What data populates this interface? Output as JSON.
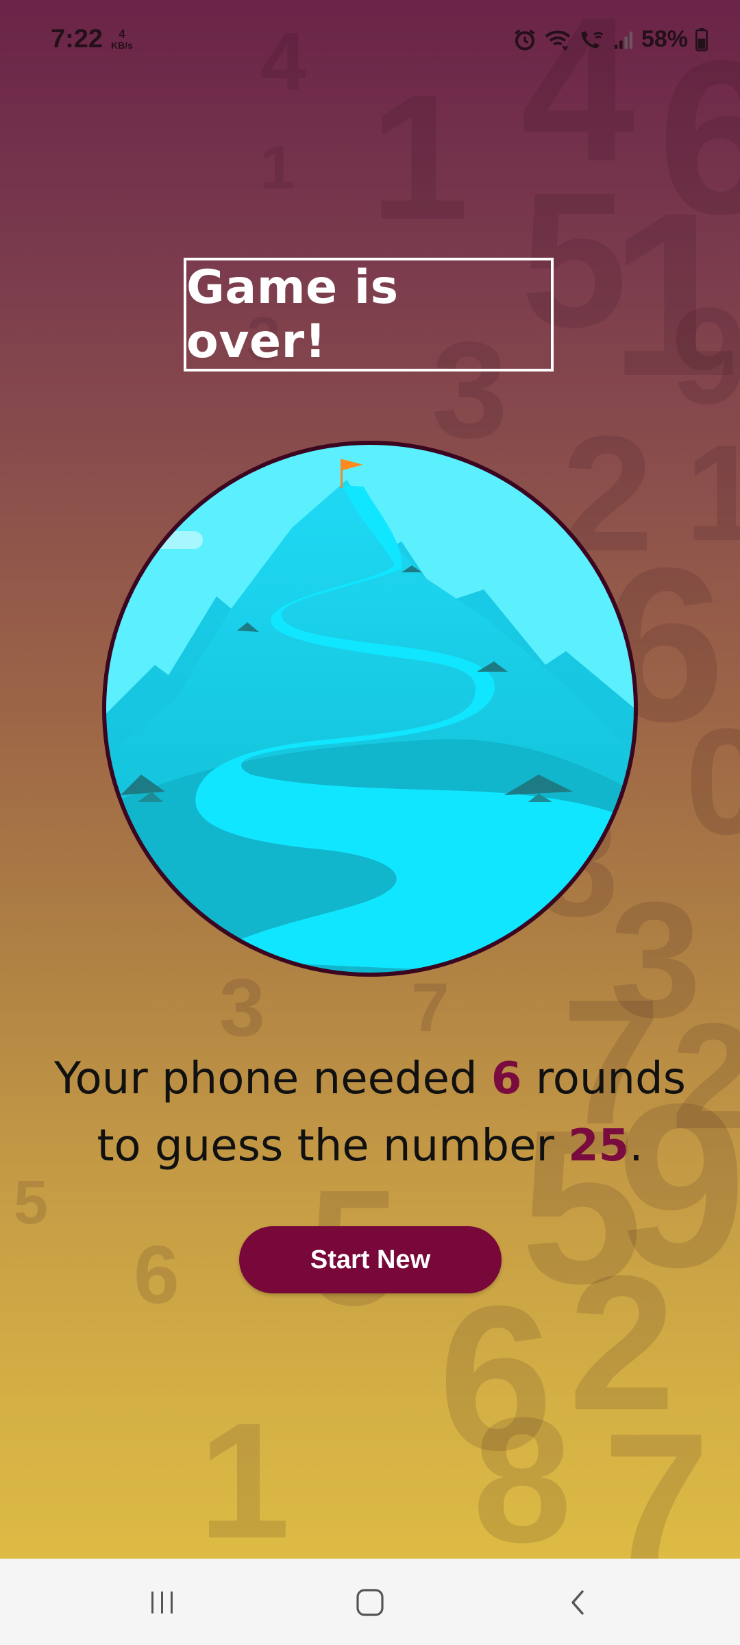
{
  "status_bar": {
    "time": "7:22",
    "net_speed_value": "4",
    "net_speed_unit": "KB/s",
    "battery": "58%"
  },
  "title": "Game is over!",
  "summary": {
    "prefix": "Your phone needed ",
    "rounds": "6",
    "middle": " rounds to guess the number ",
    "number": "25",
    "suffix": "."
  },
  "button": {
    "label": "Start New"
  },
  "colors": {
    "accent": "#770839",
    "highlight": "#7a0b3e",
    "sky": "#5cf0ff",
    "water": "#10e6ff"
  },
  "icons": {
    "status": [
      "alarm-icon",
      "wifi-icon",
      "wifi-calling-icon",
      "signal-icon",
      "battery-icon"
    ],
    "nav": [
      "recents-icon",
      "home-icon",
      "back-icon"
    ]
  }
}
